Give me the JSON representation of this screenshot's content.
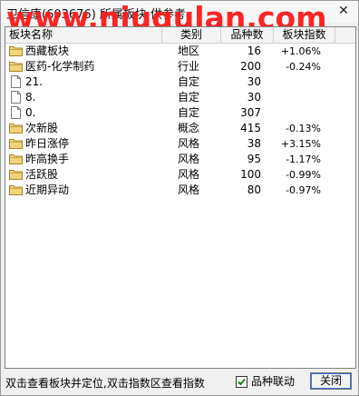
{
  "window": {
    "title": "卫信康(603676)   所属板块 供参考",
    "watermark": "www.niugulan.com",
    "close_glyph": "✕"
  },
  "table": {
    "headers": {
      "name": "板块名称",
      "type": "类别",
      "count": "品种数",
      "index": "板块指数"
    },
    "rows": [
      {
        "icon": "folder-icon",
        "name": "西藏板块",
        "type": "地区",
        "count": "16",
        "index": "+1.06%"
      },
      {
        "icon": "folder-icon",
        "name": "医药-化学制药",
        "type": "行业",
        "count": "200",
        "index": "-0.24%"
      },
      {
        "icon": "document-icon",
        "name": "21.",
        "type": "自定",
        "count": "30",
        "index": ""
      },
      {
        "icon": "document-icon",
        "name": "8.",
        "type": "自定",
        "count": "30",
        "index": ""
      },
      {
        "icon": "document-icon",
        "name": "0.",
        "type": "自定",
        "count": "307",
        "index": ""
      },
      {
        "icon": "folder-icon",
        "name": "次新股",
        "type": "概念",
        "count": "415",
        "index": "-0.13%"
      },
      {
        "icon": "folder-icon",
        "name": "昨日涨停",
        "type": "风格",
        "count": "38",
        "index": "+3.15%"
      },
      {
        "icon": "folder-icon",
        "name": "昨高换手",
        "type": "风格",
        "count": "95",
        "index": "-1.17%"
      },
      {
        "icon": "folder-icon",
        "name": "活跃股",
        "type": "风格",
        "count": "100",
        "index": "-0.99%"
      },
      {
        "icon": "folder-icon",
        "name": "近期异动",
        "type": "风格",
        "count": "80",
        "index": "-0.97%"
      }
    ]
  },
  "footer": {
    "hint": "双击查看板块并定位,双击指数区查看指数",
    "checkbox_label": "品种联动",
    "checkbox_checked": true,
    "close_button": "关闭"
  },
  "colors": {
    "watermark": "#ff1a1a",
    "folder_fill": "#f2d27a",
    "folder_stroke": "#a8852b",
    "checkmark": "#1a7f1a"
  }
}
